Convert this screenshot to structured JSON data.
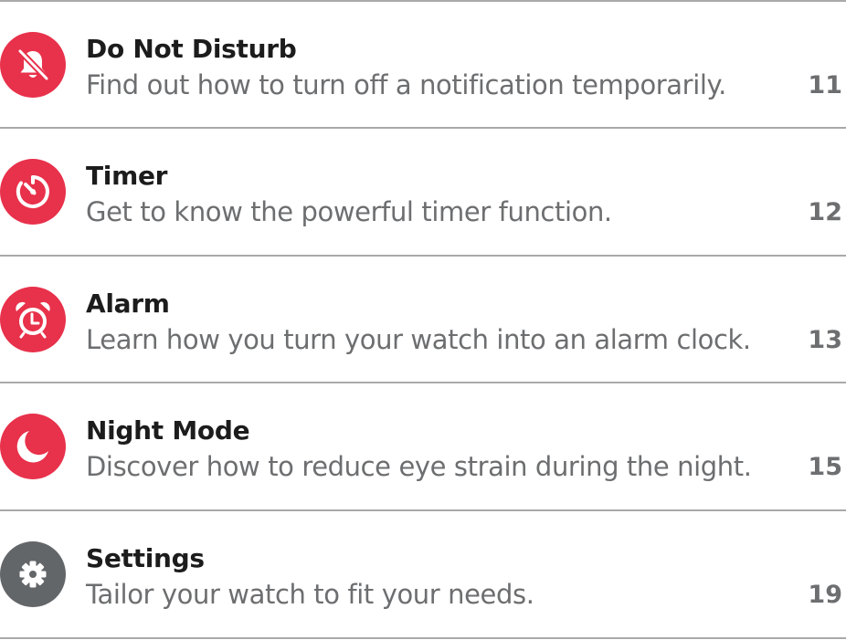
{
  "colors": {
    "accent": "#e8314b",
    "neutral": "#636669",
    "divider": "#a9a9a9",
    "title_text": "#1c1c1c",
    "body_text": "#6d6e70"
  },
  "entries": [
    {
      "icon": "bell-off-icon",
      "title": "Do Not Disturb",
      "description": "Find out how to turn off a notification temporarily.",
      "page": "11"
    },
    {
      "icon": "timer-icon",
      "title": "Timer",
      "description": "Get to know the powerful timer function.",
      "page": "12"
    },
    {
      "icon": "alarm-clock-icon",
      "title": "Alarm",
      "description": "Learn how you turn your watch into an alarm clock.",
      "page": "13"
    },
    {
      "icon": "moon-icon",
      "title": "Night Mode",
      "description": "Discover how to reduce eye strain during the night.",
      "page": "15"
    },
    {
      "icon": "gear-icon",
      "title": "Settings",
      "description": "Tailor your watch to fit your needs.",
      "page": "19"
    }
  ]
}
